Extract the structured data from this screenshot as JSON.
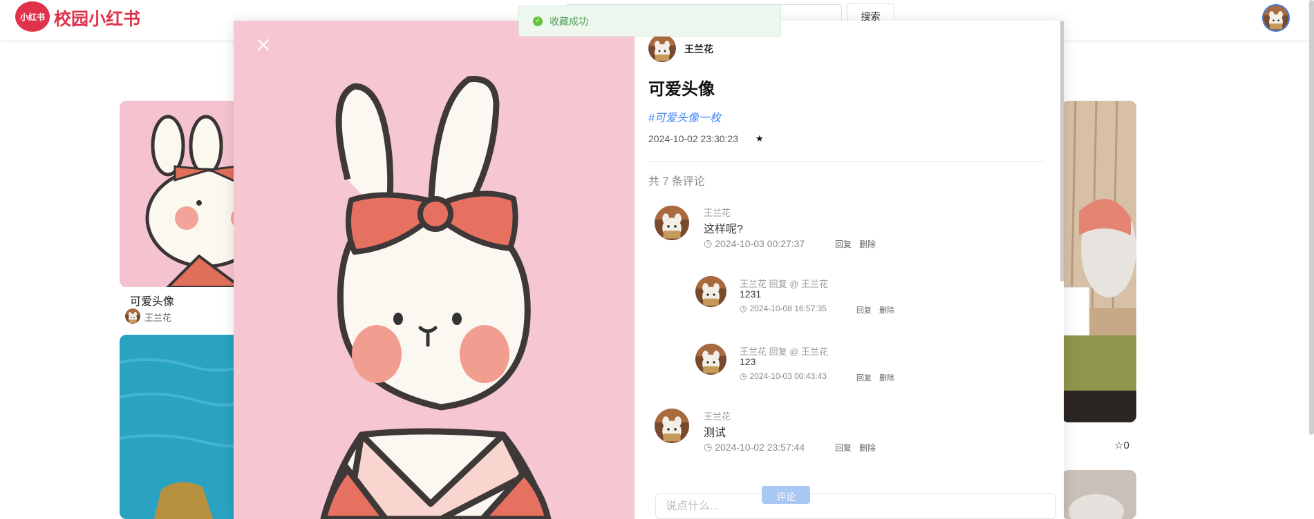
{
  "header": {
    "logo_badge": "小红书",
    "app_title": "校园小红书",
    "search_placeholder": "",
    "search_button": "搜索"
  },
  "feed": {
    "card1_title": "可爱头像",
    "card1_author": "王兰花",
    "card3_fav_count": "0"
  },
  "toast": {
    "message": "收藏成功",
    "color": "#67c23a"
  },
  "post": {
    "author": "王兰花",
    "title": "可爱头像",
    "tag": "#可爱头像一枚",
    "date": "2024-10-02 23:30:23",
    "comment_count": "共 7 条评论"
  },
  "comments": [
    {
      "author": "王兰花",
      "text": "这样呢?",
      "time": "2024-10-03 00:27:37",
      "reply_label": "回复",
      "delete_label": "删除"
    },
    {
      "author": "王兰花 回复 @ 王兰花",
      "text": "1231",
      "time": "2024-10-08 16:57:35",
      "reply_label": "回复",
      "delete_label": "删除"
    },
    {
      "author": "王兰花 回复 @ 王兰花",
      "text": "123",
      "time": "2024-10-03 00:43:43",
      "reply_label": "回复",
      "delete_label": "删除"
    },
    {
      "author": "王兰花",
      "text": "测试",
      "time": "2024-10-02 23:57:44",
      "reply_label": "回复",
      "delete_label": "删除"
    }
  ],
  "comment_box": {
    "placeholder": "说点什么...",
    "submit_label": "评论"
  },
  "colors": {
    "brand": "#e0334b",
    "accent": "#3b82f6"
  }
}
